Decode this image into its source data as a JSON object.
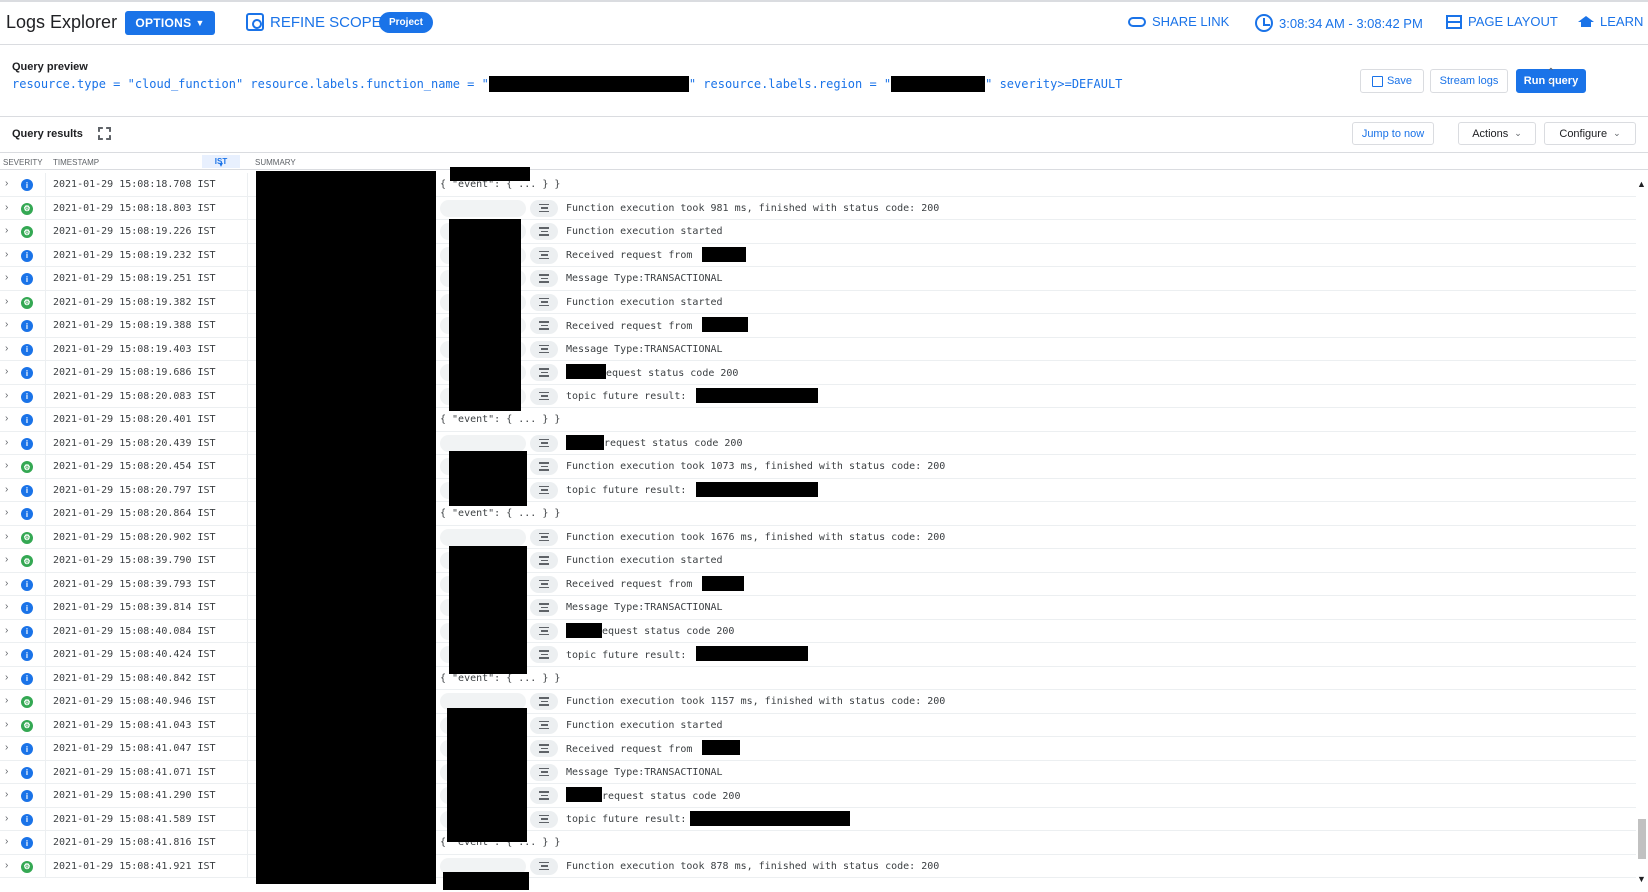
{
  "topbar": {
    "title": "Logs Explorer",
    "options_label": "OPTIONS",
    "refine_label": "REFINE SCOPE",
    "project_label": "Project",
    "share_label": "SHARE LINK",
    "time_range": "3:08:34 AM - 3:08:42 PM",
    "page_layout_label": "PAGE LAYOUT",
    "learn_label": "LEARN"
  },
  "query": {
    "label": "Query preview",
    "part1": "resource.type = \"cloud_function\" resource.labels.function_name = \"",
    "part2": "\" resource.labels.region = \"",
    "part3": "\" severity>=DEFAULT",
    "save_label": "Save",
    "stream_label": "Stream logs",
    "run_label": "Run query"
  },
  "results": {
    "label": "Query results",
    "jump_label": "Jump to now",
    "actions_label": "Actions",
    "configure_label": "Configure"
  },
  "columns": {
    "severity": "SEVERITY",
    "timestamp": "TIMESTAMP",
    "timezone": "IST",
    "summary": "SUMMARY"
  },
  "rows": [
    {
      "sev": "info",
      "ts": "2021-01-29 15:08:18.708 IST",
      "kind": "event",
      "text": "{ \"event\": { ... } }"
    },
    {
      "sev": "debug",
      "ts": "2021-01-29 15:08:18.803 IST",
      "kind": "summary",
      "text": "Function execution took 981 ms, finished with status code: 200"
    },
    {
      "sev": "debug",
      "ts": "2021-01-29 15:08:19.226 IST",
      "kind": "summary",
      "text": "Function execution started"
    },
    {
      "sev": "info",
      "ts": "2021-01-29 15:08:19.232 IST",
      "kind": "summary",
      "text": "Received request from ",
      "redact_after": 44
    },
    {
      "sev": "info",
      "ts": "2021-01-29 15:08:19.251 IST",
      "kind": "summary",
      "text": "Message Type:TRANSACTIONAL"
    },
    {
      "sev": "debug",
      "ts": "2021-01-29 15:08:19.382 IST",
      "kind": "summary",
      "text": "Function execution started"
    },
    {
      "sev": "info",
      "ts": "2021-01-29 15:08:19.388 IST",
      "kind": "summary",
      "text": "Received request from ",
      "redact_after": 46
    },
    {
      "sev": "info",
      "ts": "2021-01-29 15:08:19.403 IST",
      "kind": "summary",
      "text": "Message Type:TRANSACTIONAL"
    },
    {
      "sev": "info",
      "ts": "2021-01-29 15:08:19.686 IST",
      "kind": "summary",
      "text": "equest status code 200",
      "redact_before": 40
    },
    {
      "sev": "info",
      "ts": "2021-01-29 15:08:20.083 IST",
      "kind": "summary",
      "text": "topic future result: ",
      "redact_after": 122
    },
    {
      "sev": "info",
      "ts": "2021-01-29 15:08:20.401 IST",
      "kind": "event",
      "text": "{ \"event\": { ... } }"
    },
    {
      "sev": "info",
      "ts": "2021-01-29 15:08:20.439 IST",
      "kind": "summary",
      "text": "request status code 200",
      "redact_before": 38
    },
    {
      "sev": "debug",
      "ts": "2021-01-29 15:08:20.454 IST",
      "kind": "summary",
      "text": "Function execution took 1073 ms, finished with status code: 200"
    },
    {
      "sev": "info",
      "ts": "2021-01-29 15:08:20.797 IST",
      "kind": "summary",
      "text": "topic future result: ",
      "redact_after": 122
    },
    {
      "sev": "info",
      "ts": "2021-01-29 15:08:20.864 IST",
      "kind": "event",
      "text": "{ \"event\": { ... } }"
    },
    {
      "sev": "debug",
      "ts": "2021-01-29 15:08:20.902 IST",
      "kind": "summary",
      "text": "Function execution took 1676 ms, finished with status code: 200"
    },
    {
      "sev": "debug",
      "ts": "2021-01-29 15:08:39.790 IST",
      "kind": "summary",
      "text": "Function execution started"
    },
    {
      "sev": "info",
      "ts": "2021-01-29 15:08:39.793 IST",
      "kind": "summary",
      "text": "Received request from ",
      "redact_after": 42
    },
    {
      "sev": "info",
      "ts": "2021-01-29 15:08:39.814 IST",
      "kind": "summary",
      "text": "Message Type:TRANSACTIONAL"
    },
    {
      "sev": "info",
      "ts": "2021-01-29 15:08:40.084 IST",
      "kind": "summary",
      "text": "equest status code 200",
      "redact_before": 36
    },
    {
      "sev": "info",
      "ts": "2021-01-29 15:08:40.424 IST",
      "kind": "summary",
      "text": "topic future result: ",
      "redact_after": 112
    },
    {
      "sev": "info",
      "ts": "2021-01-29 15:08:40.842 IST",
      "kind": "event",
      "text": "{ \"event\": { ... } }"
    },
    {
      "sev": "debug",
      "ts": "2021-01-29 15:08:40.946 IST",
      "kind": "summary",
      "text": "Function execution took 1157 ms, finished with status code: 200"
    },
    {
      "sev": "debug",
      "ts": "2021-01-29 15:08:41.043 IST",
      "kind": "summary",
      "text": "Function execution started"
    },
    {
      "sev": "info",
      "ts": "2021-01-29 15:08:41.047 IST",
      "kind": "summary",
      "text": "Received request from ",
      "redact_after": 38
    },
    {
      "sev": "info",
      "ts": "2021-01-29 15:08:41.071 IST",
      "kind": "summary",
      "text": "Message Type:TRANSACTIONAL"
    },
    {
      "sev": "info",
      "ts": "2021-01-29 15:08:41.290 IST",
      "kind": "summary",
      "text": "request status code 200",
      "redact_before": 36
    },
    {
      "sev": "info",
      "ts": "2021-01-29 15:08:41.589 IST",
      "kind": "summary",
      "text": "topic future result:",
      "redact_after": 160
    },
    {
      "sev": "info",
      "ts": "2021-01-29 15:08:41.816 IST",
      "kind": "event",
      "text": "{ \"event\": { ... } }"
    },
    {
      "sev": "debug",
      "ts": "2021-01-29 15:08:41.921 IST",
      "kind": "summary",
      "text": "Function execution took 878 ms, finished with status code: 200"
    }
  ]
}
